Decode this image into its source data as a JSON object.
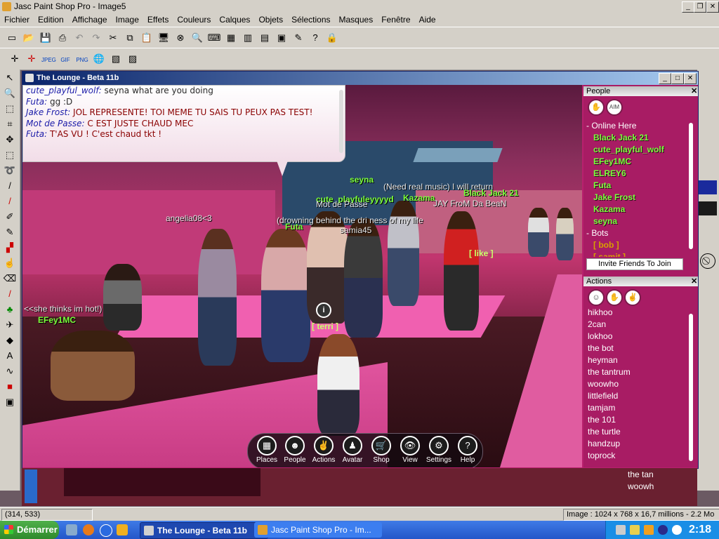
{
  "psp": {
    "title": "Jasc Paint Shop Pro - Image5",
    "menu": [
      "Fichier",
      "Edition",
      "Affichage",
      "Image",
      "Effets",
      "Couleurs",
      "Calques",
      "Objets",
      "Sélections",
      "Masques",
      "Fenêtre",
      "Aide"
    ],
    "status_coords": "(314, 533)",
    "status_image": "Image : 1024 x 768 x 16,7 millions - 2.2 Mo"
  },
  "taskbar": {
    "start": "Démarrer",
    "tasks": [
      "The Lounge - Beta 11b",
      "Jasc Paint Shop Pro - Im..."
    ],
    "clock": "2:18"
  },
  "lounge": {
    "title": "The Lounge - Beta 11b",
    "chat": [
      {
        "name": "cute_playful_wolf",
        "text": "seyna what are you doing"
      },
      {
        "name": "Futa",
        "text": "gg :D"
      },
      {
        "name": "Jake Frost",
        "text": "JOL REPRESENTE! TOI MEME TU SAIS TU PEUX PAS TEST!"
      },
      {
        "name": "Mot de Passe",
        "text": "C EST JUSTE CHAUD MEC"
      },
      {
        "name": "Futa",
        "text": "T'AS VU ! C'est chaud tkt !"
      }
    ],
    "scene_tags": {
      "seyna": "seyna",
      "cute_playful": "cute_playfuleyyyyd",
      "mot": "Mot de Passe",
      "need": "(Need real music) I will return",
      "kazama": "Kazama",
      "blackjack": "Black Jack 21",
      "jay": "JAY FroM Da BeaN",
      "angelia": "angelia08<3",
      "drowning": "(drowning behind the dri ness of my life",
      "futa": "Futa",
      "samia": "samia45",
      "like": "[ like ]",
      "she": "<<she thinks im hot!)",
      "efey": "EFey1MC",
      "terri": "[ terri ]"
    },
    "dock": [
      "Places",
      "People",
      "Actions",
      "Avatar",
      "Shop",
      "View",
      "Settings",
      "Help"
    ],
    "dock_icons": [
      "places-icon",
      "people-icon",
      "actions-icon",
      "avatar-icon",
      "shop-icon",
      "view-icon",
      "settings-icon",
      "help-icon"
    ],
    "people": {
      "header": "People",
      "online_label": "- Online Here",
      "online": [
        "Black Jack 21",
        "cute_playful_wolf",
        "EFey1MC",
        "ELREY6",
        "Futa",
        "Jake Frost",
        "Kazama",
        "seyna"
      ],
      "bots_label": "- Bots",
      "bots": [
        "[ bob ]",
        "[ samit ]"
      ],
      "invite": "Invite Friends To Join"
    },
    "actions": {
      "header": "Actions",
      "items": [
        "hikhoo",
        "2can",
        "lokhoo",
        "the bot",
        "heyman",
        "the tantrum",
        "woowho",
        "littlefield",
        "tamjam",
        "the 101",
        "the turtle",
        "handzup",
        "toprock"
      ]
    },
    "behind": [
      "the tan",
      "woowh"
    ],
    "colors": {
      "panel": "#a81c64",
      "online_name": "#7cff3c",
      "chat_name": "#1a1aa8",
      "chat_text": "#8a0000"
    }
  }
}
